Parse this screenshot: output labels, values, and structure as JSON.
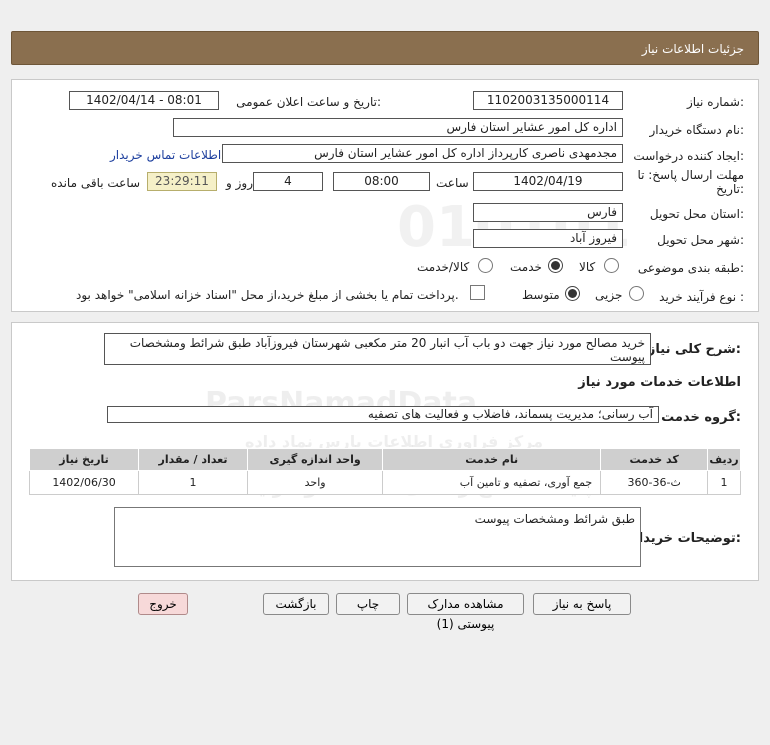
{
  "header": {
    "title": "جزئیات اطلاعات نیاز"
  },
  "form": {
    "need_number_label": "شماره نیاز:",
    "need_number": "1102003135000114",
    "announce_label": "تاریخ و ساعت اعلان عمومی:",
    "announce_value": "1402/04/14 - 08:01",
    "buyer_org_label": "نام دستگاه خریدار:",
    "buyer_org": "اداره کل امور عشایر استان فارس",
    "creator_label": "ایجاد کننده درخواست:",
    "creator": "مجدمهدی ناصری کارپرداز اداره کل امور عشایر استان فارس",
    "contact_link": "اطلاعات تماس خریدار",
    "deadline_label_1": "مهلت ارسال پاسخ: تا",
    "deadline_label_2": "تاریخ:",
    "deadline_date": "1402/04/19",
    "time_label": "ساعت",
    "deadline_time": "08:00",
    "days": "4",
    "days_label": "روز و",
    "remaining_time": "23:29:11",
    "remaining_label": "ساعت باقی مانده",
    "province_label": "استان محل تحویل:",
    "province": "فارس",
    "city_label": "شهر محل تحویل:",
    "city": "فیروز آباد",
    "category_label": "طبقه بندی موضوعی:",
    "category_options": [
      "کالا",
      "خدمت",
      "کالا/خدمت"
    ],
    "category_selected": "خدمت",
    "process_label": "نوع فرآیند خرید :",
    "process_options": [
      "جزیی",
      "متوسط"
    ],
    "process_selected": "متوسط",
    "payment_note": "پرداخت تمام یا بخشی از مبلغ خرید،از محل \"اسناد خزانه اسلامی\" خواهد بود."
  },
  "details": {
    "summary_label": "شرح کلی نیاز:",
    "summary": "خرید مصالح مورد نیاز جهت دو باب آب انبار 20 متر مکعبی  شهرستان فیروزآباد طبق شرائط ومشخصات پیوست",
    "services_heading": "اطلاعات خدمات مورد نیاز",
    "service_group_label": "گروه خدمت:",
    "service_group": "آب رسانی؛ مدیریت پسماند، فاضلاب و فعالیت های تصفیه",
    "table": {
      "headers": [
        "ردیف",
        "کد خدمت",
        "نام خدمت",
        "واحد اندازه گیری",
        "تعداد / مقدار",
        "تاریخ نیاز"
      ],
      "rows": [
        [
          "1",
          "ث-36-360",
          "جمع آوری، تصفیه و تامین آب",
          "واحد",
          "1",
          "1402/06/30"
        ]
      ]
    },
    "buyer_notes_label": "توضیحات خریدار:",
    "buyer_notes": "طبق شرائط ومشخصات پیوست"
  },
  "buttons": {
    "reply": "پاسخ به نیاز",
    "attachments": "مشاهده مدارک پیوستی (1)",
    "print": "چاپ",
    "back": "بازگشت",
    "exit": "خروج"
  },
  "watermark": {
    "text1": "ParsNamadData",
    "text2": "مرکز فراوری اطلاعات پارس نماد داده",
    "text3": "پایگاه اطلاع رسانی مناقصه و مزایده",
    "phone": "۰۲۱-۸۸۳۴۹۶۷۰-۵"
  },
  "colors": {
    "header_bg": "#8a6f4f",
    "timer_bg": "#f5f0c8",
    "link": "#1d3f9e",
    "exit_button": "#f7d9d9"
  }
}
